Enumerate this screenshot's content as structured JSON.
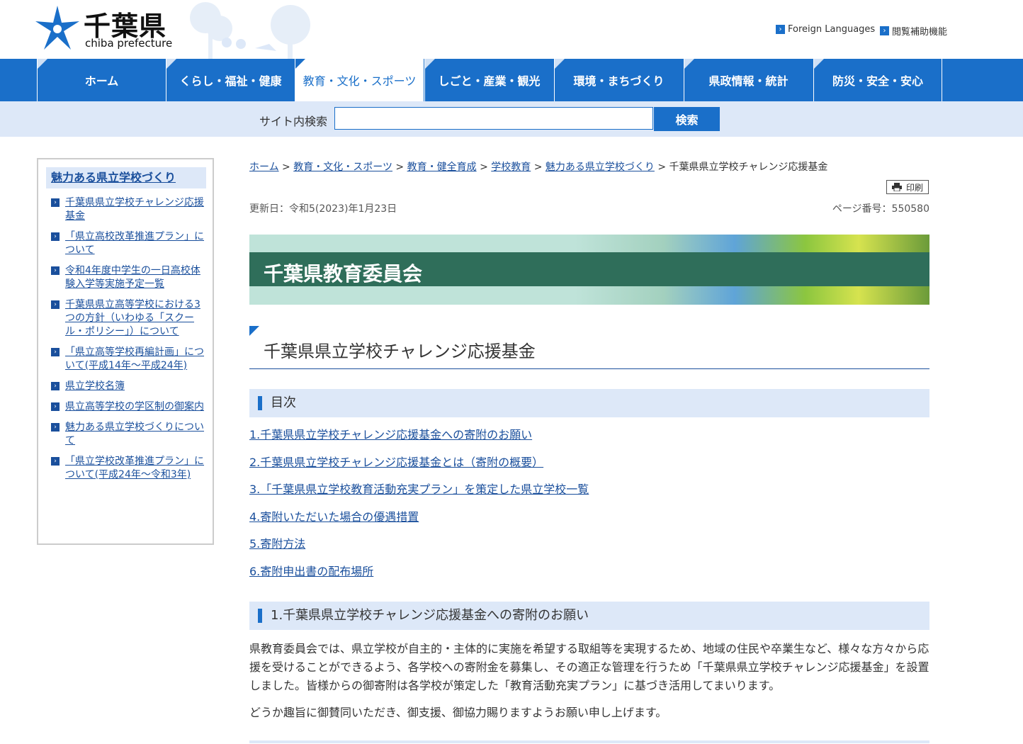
{
  "header": {
    "logo_jp": "千葉県",
    "logo_en": "chiba prefecture",
    "util_links": [
      {
        "label": "Foreign Languages"
      },
      {
        "label": "閲覧補助機能"
      }
    ]
  },
  "gnav": [
    {
      "label": "ホーム"
    },
    {
      "label": "くらし・福祉・健康"
    },
    {
      "label": "教育・文化・スポーツ",
      "active": true
    },
    {
      "label": "しごと・産業・観光"
    },
    {
      "label": "環境・まちづくり"
    },
    {
      "label": "県政情報・統計"
    },
    {
      "label": "防災・安全・安心"
    }
  ],
  "search": {
    "label": "サイト内検索",
    "value": "",
    "button": "検索"
  },
  "sidebar": {
    "title": "魅力ある県立学校づくり",
    "items": [
      {
        "label": "千葉県県立学校チャレンジ応援基金"
      },
      {
        "label": "「県立高校改革推進プラン」について"
      },
      {
        "label": "令和4年度中学生の一日高校体験入学等実施予定一覧"
      },
      {
        "label": "千葉県県立高等学校における3つの方針（いわゆる「スクール・ポリシー」）について"
      },
      {
        "label": "「県立高等学校再編計画」について(平成14年～平成24年)"
      },
      {
        "label": "県立学校名簿"
      },
      {
        "label": "県立高等学校の学区制の御案内"
      },
      {
        "label": "魅力ある県立学校づくりについて"
      },
      {
        "label": "「県立学校改革推進プラン」について(平成24年～令和3年)"
      }
    ]
  },
  "breadcrumb": {
    "links": [
      "ホーム",
      "教育・文化・スポーツ",
      "教育・健全育成",
      "学校教育",
      "魅力ある県立学校づくり"
    ],
    "sep": ">",
    "current": "千葉県県立学校チャレンジ応援基金"
  },
  "print_label": "印刷",
  "meta": {
    "updated": "更新日：令和5(2023)年1月23日",
    "page_number": "ページ番号：550580"
  },
  "banner": {
    "title": "千葉県教育委員会"
  },
  "page_title": "千葉県県立学校チャレンジ応援基金",
  "toc": {
    "heading": "目次",
    "items": [
      "1.千葉県県立学校チャレンジ応援基金への寄附のお願い",
      "2.千葉県県立学校チャレンジ応援基金とは（寄附の概要）",
      "3.「千葉県県立学校教育活動充実プラン」を策定した県立学校一覧",
      "4.寄附いただいた場合の優遇措置",
      "5.寄附方法",
      "6.寄附申出書の配布場所"
    ]
  },
  "section1": {
    "heading": "1.千葉県県立学校チャレンジ応援基金への寄附のお願い",
    "para1": "県教育委員会では、県立学校が自主的・主体的に実施を希望する取組等を実現するため、地域の住民や卒業生など、様々な方々から応援を受けることができるよう、各学校への寄附金を募集し、その適正な管理を行うため「千葉県県立学校チャレンジ応援基金」を設置しました。皆様からの御寄附は各学校が策定した「教育活動充実プラン」に基づき活用してまいります。",
    "para2": "どうか趣旨に御賛同いただき、御支援、御協力賜りますようお願い申し上げます。"
  },
  "colors": {
    "accent": "#1a6fc9",
    "link": "#1a4f9c",
    "light_bg": "#dde8f8",
    "banner_green": "#2f6e5a"
  }
}
